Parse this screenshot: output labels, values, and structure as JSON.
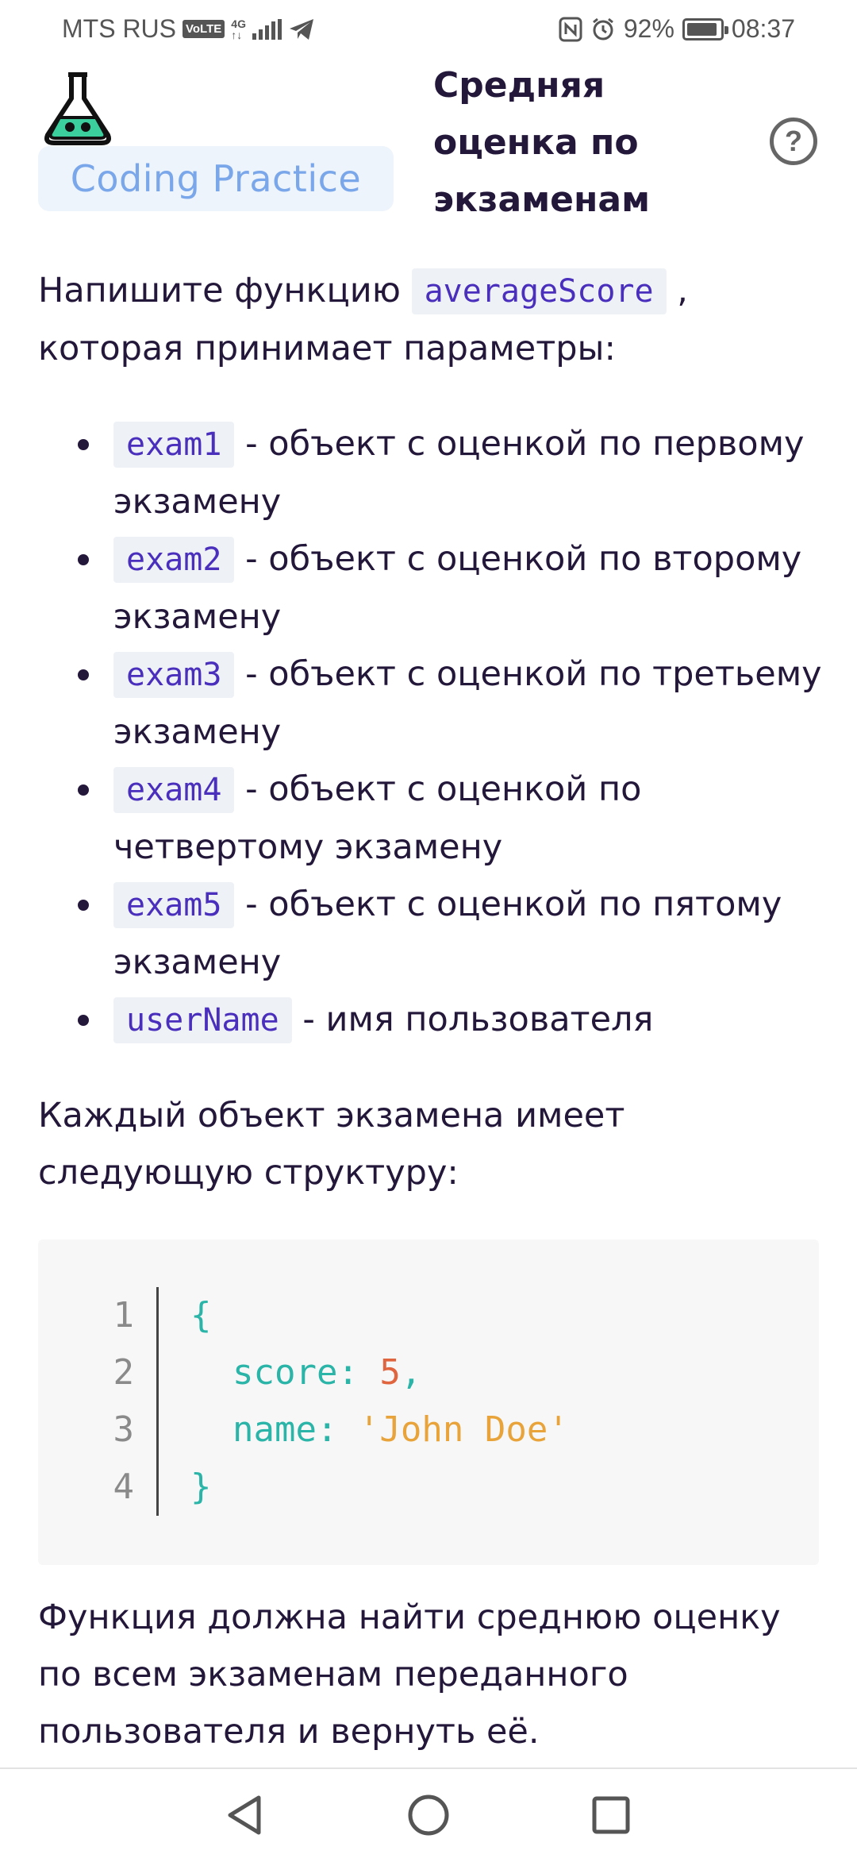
{
  "status_bar": {
    "carrier": "MTS RUS",
    "volte": "VoLTE",
    "network": "4G",
    "battery_percent": "92%",
    "battery_level": 0.92,
    "time": "08:37"
  },
  "header": {
    "badge": "Coding Practice",
    "title": "Средняя оценка по экзаменам",
    "help_icon": "question-circle-icon"
  },
  "content": {
    "intro_before": "Напишите функцию",
    "intro_code": "averageScore",
    "intro_after": ", которая принимает параметры:",
    "params": [
      {
        "code": "exam1",
        "text": "- объект с оценкой по первому экзамену"
      },
      {
        "code": "exam2",
        "text": "- объект с оценкой по второму экзамену"
      },
      {
        "code": "exam3",
        "text": "- объект с оценкой по третьему экзамену"
      },
      {
        "code": "exam4",
        "text": "- объект с оценкой по четвертому экзамену"
      },
      {
        "code": "exam5",
        "text": "- объект с оценкой по пятому экзамену"
      },
      {
        "code": "userName",
        "text": "- имя пользователя"
      }
    ],
    "structure_text": "Каждый объект экзамена имеет следующую структуру:",
    "code_block": {
      "line_numbers": [
        "1",
        "2",
        "3",
        "4"
      ],
      "open_brace": "{",
      "score_key": "score: ",
      "score_value": "5",
      "comma": ",",
      "name_key": "name: ",
      "name_value": "'John Doe'",
      "close_brace": "}"
    },
    "task_text": "Функция должна найти среднюю оценку по всем экзаменам переданного пользователя и вернуть её."
  },
  "nav_bar": {
    "back": "back-triangle-icon",
    "home": "home-circle-icon",
    "recents": "recents-square-icon"
  }
}
